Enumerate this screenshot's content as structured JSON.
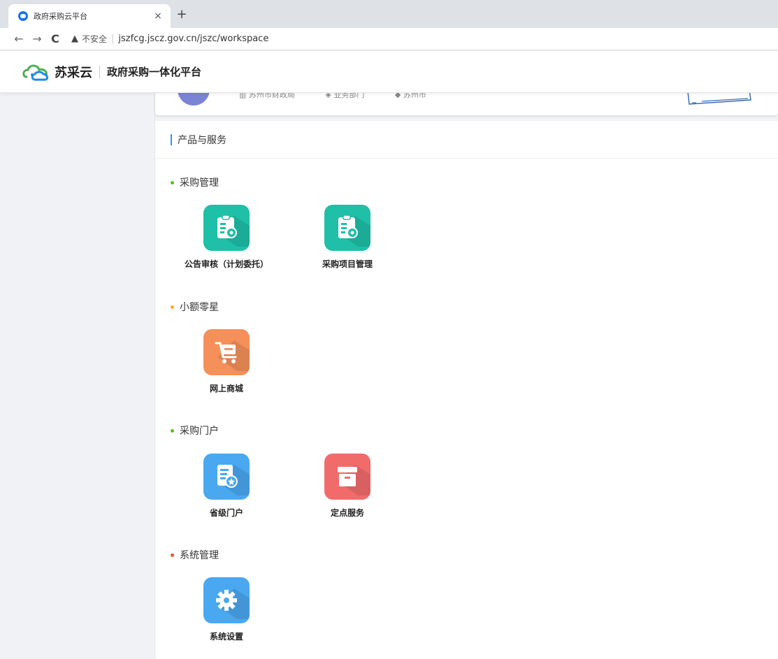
{
  "browser": {
    "tab_title": "政府采购云平台",
    "tab_close": "×",
    "new_tab": "+",
    "back": "←",
    "forward": "→",
    "reload": "C",
    "warning_icon": "▲",
    "insecure_label": "不安全",
    "separator": "|",
    "url": "jszfcg.jscz.gov.cn/jszc/workspace"
  },
  "header": {
    "brand": "苏采云",
    "platform": "政府采购一体化平台",
    "logo_colors": [
      "#4cb050",
      "#1e88e5"
    ]
  },
  "profile": {
    "org": "苏州市财政局",
    "dept": "业务部门",
    "region": "苏州市"
  },
  "main": {
    "section_title": "产品与服务",
    "groups": [
      {
        "title": "采购管理",
        "dot_color": "#52c41a",
        "apps": [
          {
            "label": "公告审核（计划委托）",
            "icon": "clipboard-icon",
            "color": "#1fbfa8"
          },
          {
            "label": "采购项目管理",
            "icon": "clipboard-icon",
            "color": "#1fbfa8"
          }
        ]
      },
      {
        "title": "小额零星",
        "dot_color": "#faad14",
        "apps": [
          {
            "label": "网上商城",
            "icon": "cart-icon",
            "color": "#f5905a"
          }
        ]
      },
      {
        "title": "采购门户",
        "dot_color": "#52c41a",
        "apps": [
          {
            "label": "省级门户",
            "icon": "document-icon",
            "color": "#4aa8f0"
          },
          {
            "label": "定点服务",
            "icon": "box-icon",
            "color": "#f26b6b"
          }
        ]
      },
      {
        "title": "系统管理",
        "dot_color": "#e8542f",
        "apps": [
          {
            "label": "系统设置",
            "icon": "gear-icon",
            "color": "#4aa8f0"
          }
        ]
      }
    ]
  }
}
